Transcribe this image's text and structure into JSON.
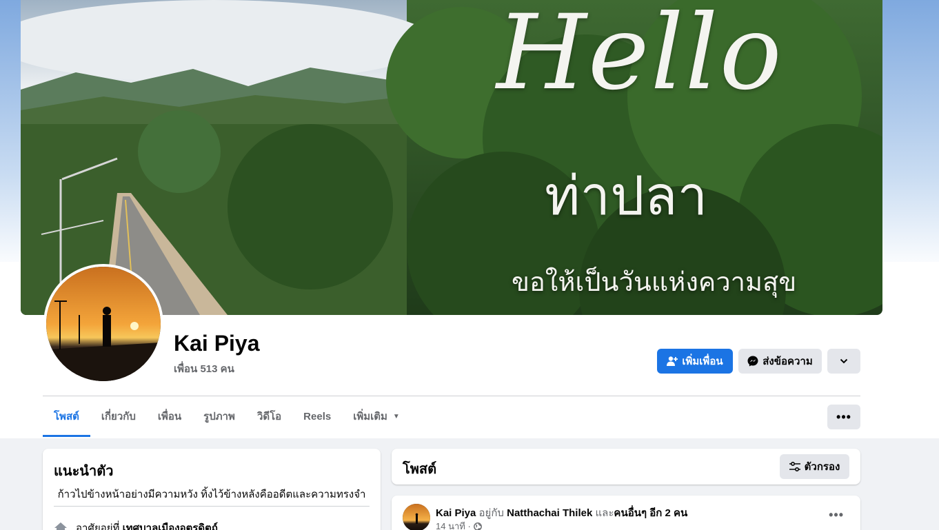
{
  "cover": {
    "greeting": "Hello",
    "place": "ท่าปลา",
    "wish": "ขอให้เป็นวันแห่งความสุข"
  },
  "profile": {
    "name": "Kai Piya",
    "friends": "เพื่อน 513 คน"
  },
  "actions": {
    "add_friend": "เพิ่มเพื่อน",
    "message": "ส่งข้อความ"
  },
  "tabs": [
    {
      "label": "โพสต์"
    },
    {
      "label": "เกี่ยวกับ"
    },
    {
      "label": "เพื่อน"
    },
    {
      "label": "รูปภาพ"
    },
    {
      "label": "วิดีโอ"
    },
    {
      "label": "Reels"
    },
    {
      "label": "เพิ่มเติม"
    }
  ],
  "intro": {
    "title": "แนะนำตัว",
    "bio": "ก้าวไปข้างหน้าอย่างมีความหวัง ทิ้งไว้ข้างหลังคืออดีตและความทรงจำ",
    "lives_prefix": "อาศัยอยู่ที่",
    "lives_place": "เทศบาลเมืองอุตรดิตถ์"
  },
  "posts": {
    "title": "โพสต์",
    "filter_label": "ตัวกรอง"
  },
  "post": {
    "author": "Kai Piya",
    "with_word": "อยู่กับ",
    "tagged": "Natthachai Thilek",
    "and_word": "และ",
    "others": "คนอื่นๆ อีก 2 คน",
    "time": "14 นาที ·"
  },
  "icons": {
    "add_friend": "add-person-icon",
    "message": "messenger-icon",
    "more": "chevron-down-icon",
    "dots": "more-dots-icon",
    "filter": "filter-icon",
    "home": "home-icon",
    "globe": "globe-icon"
  },
  "colors": {
    "accent": "#1b74e4",
    "button_gray": "#e4e6eb",
    "secondary_text": "#65676b"
  }
}
